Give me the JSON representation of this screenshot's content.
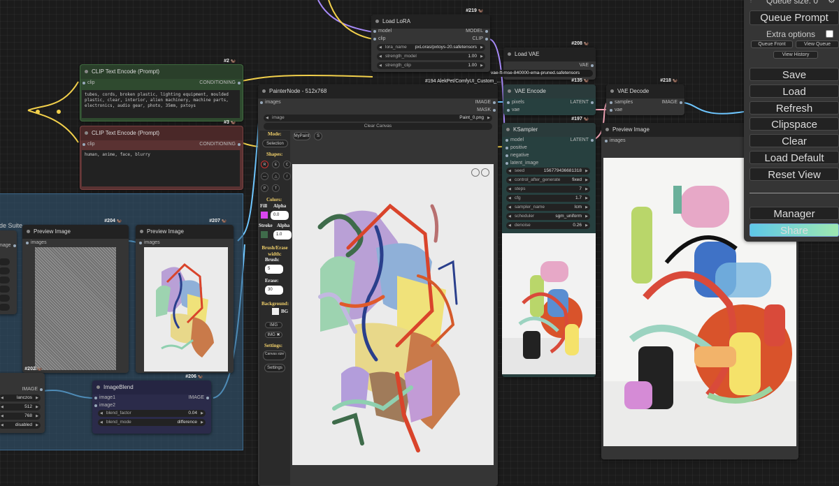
{
  "colors": {
    "canvas_bg": "#1b1b1b",
    "node_bg": "#353535",
    "clip_green": "#2f4a2f",
    "clip_red": "#5a3232",
    "share_gradient": "#8ce0c0",
    "group_blue": "#355b7a",
    "painter_swatch": "#d946ef"
  },
  "menu": {
    "queue_size": "Queue size: 0",
    "queue_prompt": "Queue Prompt",
    "extra_options": "Extra options",
    "queue_front": "Queue Front",
    "view_queue": "View Queue",
    "view_history": "View History",
    "save": "Save",
    "load": "Load",
    "refresh": "Refresh",
    "clipspace": "Clipspace",
    "clear": "Clear",
    "load_default": "Load Default",
    "reset_view": "Reset View",
    "manager": "Manager",
    "share": "Share"
  },
  "lora": {
    "id": "#219",
    "title": "Load LoRA",
    "in_model": "model",
    "in_clip": "clip",
    "out_model": "MODEL",
    "out_clip": "CLIP",
    "w1_label": "lora_name",
    "w1_value": "pxLoras/pxtoys-20.safetensors",
    "w2_label": "strength_model",
    "w2_value": "1.00",
    "w3_label": "strength_clip",
    "w3_value": "1.00"
  },
  "clip_pos": {
    "id": "#2",
    "title": "CLIP Text Encode (Prompt)",
    "in": "clip",
    "out": "CONDITIONING",
    "text": "tubes, cords, broken plastic, lighting equipment, moulded plastic, clear, interior, alien machinery, machine parts, electronics, audio gear, photo, 35mm, pxtoys"
  },
  "clip_neg": {
    "id": "#3",
    "title": "CLIP Text Encode (Prompt)",
    "in": "clip",
    "out": "CONDITIONING",
    "text": "human, anime, face, blurry"
  },
  "vae_loader": {
    "id": "#208",
    "title": "Load VAE",
    "out": "VAE",
    "widget": "vae-ft-mse-840000-ema-pruned.safetensors"
  },
  "painter": {
    "title": "PainterNode - 512x768",
    "in": "images",
    "out_image": "IMAGE",
    "out_mask": "MASK",
    "image_label": "image",
    "image_value": "Paint_0.png",
    "clear": "Clear Canvas",
    "mode": "Mode:",
    "mypaint": "MyPaint",
    "s": "S",
    "selection": "Selection",
    "shapes": "Shapes:",
    "colors": "Colors:",
    "fill": "Fill",
    "alpha1": "Alpha",
    "alpha1_val": "0.0",
    "stroke": "Stroke",
    "alpha2": "Alpha",
    "alpha2_val": "1.0",
    "brush_erase": "Brush/Erase width:",
    "brush": "Brush:",
    "brush_val": "5",
    "erase": "Erase:",
    "erase_val": "30",
    "background": "Background:",
    "bg": "BG",
    "img1": "IMG",
    "img2": "IMG ✖",
    "settings_label": "Settings:",
    "canvas": "Canvas size",
    "settings": "Settings",
    "tools": [
      "R",
      "E",
      "C",
      "—",
      "△",
      "/",
      "P",
      "T"
    ]
  },
  "custom_label": "#194 AlekPet/ComfyUI_Custom_...",
  "vae_encode": {
    "id": "#135",
    "title": "VAE Encode",
    "in_pixels": "pixels",
    "in_vae": "vae",
    "out": "LATENT"
  },
  "vae_decode": {
    "id": "#218",
    "title": "VAE Decode",
    "in_samples": "samples",
    "in_vae": "vae",
    "out": "IMAGE"
  },
  "ksampler": {
    "id": "#197",
    "title": "KSampler",
    "in": [
      "model",
      "positive",
      "negative",
      "latent_image"
    ],
    "out": "LATENT",
    "widgets": [
      {
        "label": "seed",
        "value": "156779436681318"
      },
      {
        "label": "control_after_generate",
        "value": "fixed"
      },
      {
        "label": "steps",
        "value": "7"
      },
      {
        "label": "cfg",
        "value": "1.7"
      },
      {
        "label": "sampler_name",
        "value": "lcm"
      },
      {
        "label": "scheduler",
        "value": "sgm_uniform"
      },
      {
        "label": "denoise",
        "value": "0.26"
      }
    ]
  },
  "preview_main": {
    "title": "Preview Image",
    "in": "images"
  },
  "group": {
    "title": "de Suite"
  },
  "left_stub": {
    "slot": "mage"
  },
  "preview_204": {
    "id": "#204",
    "title": "Preview Image",
    "in": "images"
  },
  "preview_207": {
    "id": "#207",
    "title": "Preview Image",
    "in": "images"
  },
  "node_202": {
    "id": "#202",
    "out": "IMAGE",
    "values": [
      "lanczos",
      "512",
      "768",
      "disabled"
    ]
  },
  "blend": {
    "id": "#206",
    "title": "ImageBlend",
    "in1": "image1",
    "in2": "image2",
    "out": "IMAGE",
    "w1_label": "blend_factor",
    "w1_value": "0.04",
    "w2_label": "blend_mode",
    "w2_value": "difference"
  }
}
